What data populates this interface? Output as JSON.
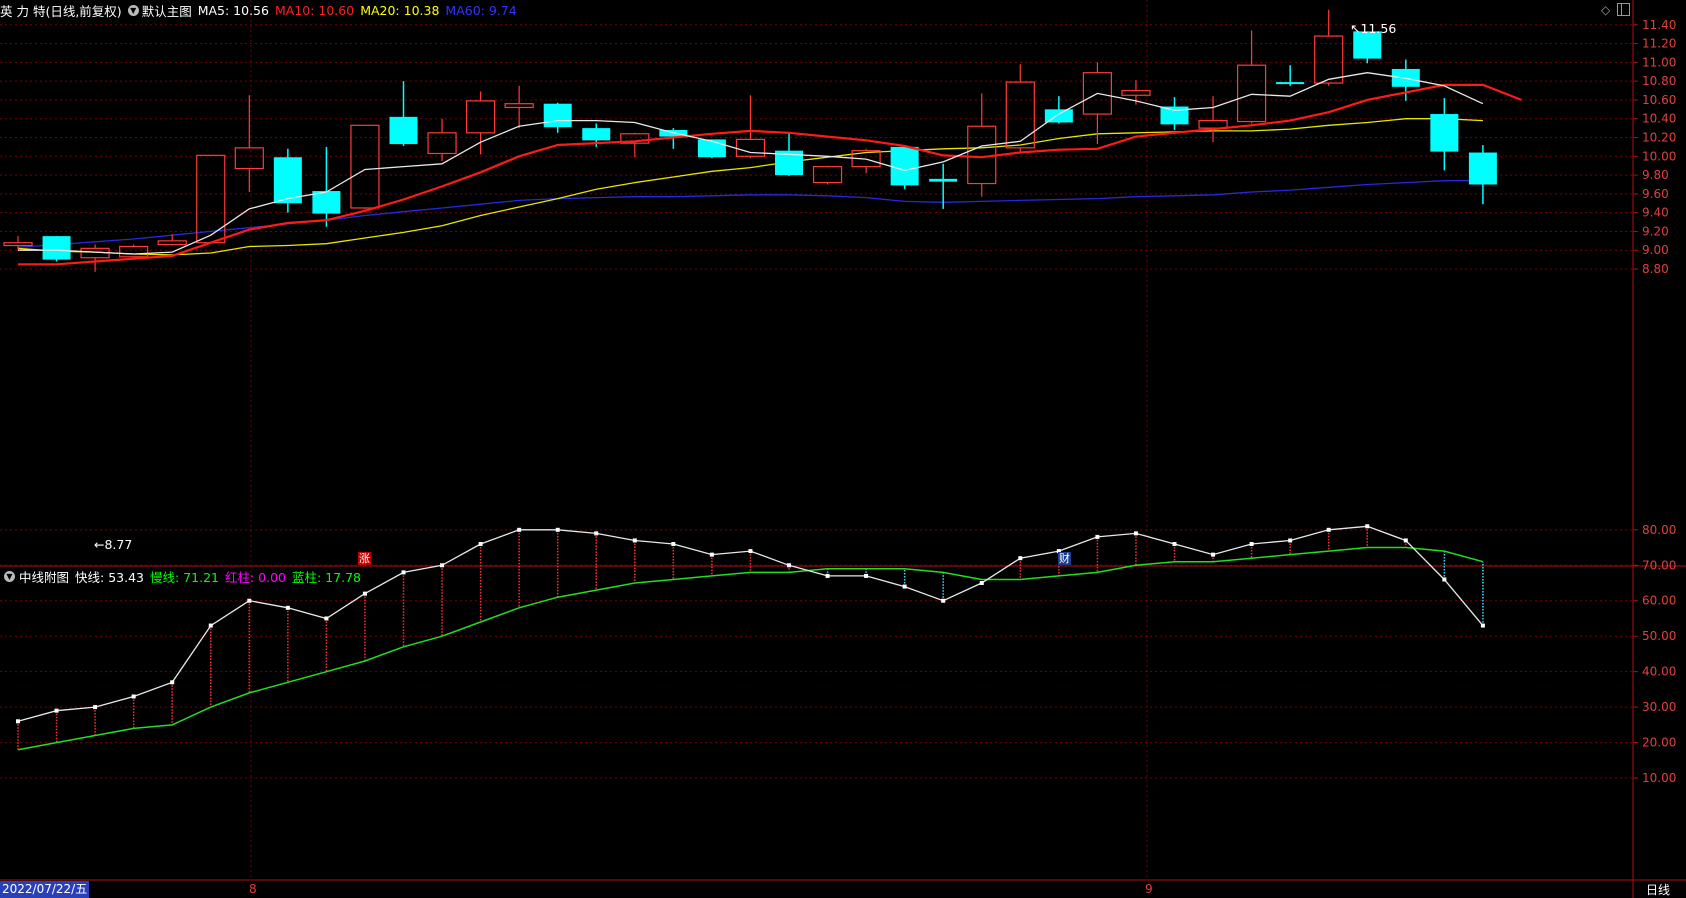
{
  "main_header": {
    "stock_name": "英 力 特",
    "period": "(日线,前复权)",
    "indicator_menu": "默认主图",
    "ma5": "MA5: 10.56",
    "ma10": "MA10: 10.60",
    "ma20": "MA20: 10.38",
    "ma60": "MA60: 9.74",
    "colors": {
      "ma5": "#ffffff",
      "ma10": "#ff2020",
      "ma20": "#ffff00",
      "ma60": "#3333ff"
    }
  },
  "sub_header": {
    "indicator_menu": "中线附图",
    "fast": "快线: 53.43",
    "slow": "慢线: 71.21",
    "red_bar": "红柱: 0.00",
    "blue_bar": "蓝柱: 17.78",
    "colors": {
      "fast": "#ffffff",
      "slow": "#00ff00",
      "red": "#ff00ff",
      "blue": "#00ff00"
    }
  },
  "annotations": {
    "high": "11.56",
    "low": "8.77"
  },
  "markers": {
    "zhang": "涨",
    "cai": "财"
  },
  "bottom": {
    "date": "2022/07/22/五",
    "month_aug": "8",
    "month_sep": "9",
    "period_button": "日线"
  },
  "chart_data": [
    {
      "type": "candlestick",
      "title": "",
      "ylim": [
        8.7,
        11.7
      ],
      "y_ticks": [
        "11.40",
        "11.20",
        "11.00",
        "10.80",
        "10.60",
        "10.40",
        "10.20",
        "10.00",
        "9.80",
        "9.60",
        "9.40",
        "9.20",
        "9.00",
        "8.80"
      ],
      "candles": [
        {
          "o": 9.05,
          "c": 9.08,
          "h": 9.15,
          "l": 9.0
        },
        {
          "o": 9.15,
          "c": 8.9,
          "h": 9.15,
          "l": 8.88
        },
        {
          "o": 8.92,
          "c": 9.02,
          "h": 9.06,
          "l": 8.77
        },
        {
          "o": 8.93,
          "c": 9.04,
          "h": 9.06,
          "l": 8.92
        },
        {
          "o": 9.06,
          "c": 9.1,
          "h": 9.17,
          "l": 9.05
        },
        {
          "o": 9.08,
          "c": 10.01,
          "h": 10.01,
          "l": 9.08
        },
        {
          "o": 9.87,
          "c": 10.09,
          "h": 10.65,
          "l": 9.62
        },
        {
          "o": 9.99,
          "c": 9.5,
          "h": 10.08,
          "l": 9.4
        },
        {
          "o": 9.63,
          "c": 9.39,
          "h": 10.1,
          "l": 9.25
        },
        {
          "o": 9.45,
          "c": 10.33,
          "h": 10.33,
          "l": 9.44
        },
        {
          "o": 10.42,
          "c": 10.13,
          "h": 10.8,
          "l": 10.11
        },
        {
          "o": 10.03,
          "c": 10.25,
          "h": 10.4,
          "l": 9.95
        },
        {
          "o": 10.25,
          "c": 10.59,
          "h": 10.69,
          "l": 10.02
        },
        {
          "o": 10.52,
          "c": 10.56,
          "h": 10.75,
          "l": 10.3
        },
        {
          "o": 10.56,
          "c": 10.31,
          "h": 10.57,
          "l": 10.25
        },
        {
          "o": 10.3,
          "c": 10.17,
          "h": 10.35,
          "l": 10.1
        },
        {
          "o": 10.14,
          "c": 10.24,
          "h": 10.25,
          "l": 9.99
        },
        {
          "o": 10.28,
          "c": 10.21,
          "h": 10.3,
          "l": 10.08
        },
        {
          "o": 10.18,
          "c": 9.99,
          "h": 10.18,
          "l": 9.98
        },
        {
          "o": 10.0,
          "c": 10.18,
          "h": 10.65,
          "l": 9.98
        },
        {
          "o": 10.06,
          "c": 9.8,
          "h": 10.25,
          "l": 9.79
        },
        {
          "o": 9.72,
          "c": 9.89,
          "h": 9.9,
          "l": 9.7
        },
        {
          "o": 9.89,
          "c": 10.06,
          "h": 10.08,
          "l": 9.82
        },
        {
          "o": 10.1,
          "c": 9.69,
          "h": 10.12,
          "l": 9.65
        },
        {
          "o": 9.76,
          "c": 9.73,
          "h": 9.92,
          "l": 9.44
        },
        {
          "o": 9.71,
          "c": 10.32,
          "h": 10.67,
          "l": 9.57
        },
        {
          "o": 10.09,
          "c": 10.79,
          "h": 10.98,
          "l": 10.03
        },
        {
          "o": 10.5,
          "c": 10.36,
          "h": 10.64,
          "l": 10.35
        },
        {
          "o": 10.45,
          "c": 10.89,
          "h": 11.0,
          "l": 10.13
        },
        {
          "o": 10.65,
          "c": 10.7,
          "h": 10.81,
          "l": 10.55
        },
        {
          "o": 10.53,
          "c": 10.34,
          "h": 10.63,
          "l": 10.28
        },
        {
          "o": 10.3,
          "c": 10.38,
          "h": 10.64,
          "l": 10.15
        },
        {
          "o": 10.37,
          "c": 10.97,
          "h": 11.34,
          "l": 10.35
        },
        {
          "o": 10.79,
          "c": 10.77,
          "h": 10.97,
          "l": 10.75
        },
        {
          "o": 10.78,
          "c": 11.28,
          "h": 11.56,
          "l": 10.75
        },
        {
          "o": 11.33,
          "c": 11.04,
          "h": 11.33,
          "l": 10.99
        },
        {
          "o": 10.93,
          "c": 10.74,
          "h": 11.03,
          "l": 10.59
        },
        {
          "o": 10.45,
          "c": 10.05,
          "h": 10.62,
          "l": 9.85
        },
        {
          "o": 10.04,
          "c": 9.7,
          "h": 10.12,
          "l": 9.49
        }
      ],
      "ma5": [
        9.0,
        9.0,
        8.98,
        8.96,
        8.98,
        9.16,
        9.44,
        9.55,
        9.62,
        9.86,
        9.89,
        9.92,
        10.15,
        10.32,
        10.38,
        10.38,
        10.36,
        10.25,
        10.16,
        10.04,
        10.02,
        10.0,
        9.97,
        9.85,
        9.94,
        10.11,
        10.16,
        10.45,
        10.67,
        10.59,
        10.49,
        10.52,
        10.66,
        10.64,
        10.82,
        10.89,
        10.83,
        10.75,
        10.56
      ],
      "ma10": [
        8.85,
        8.85,
        8.88,
        8.91,
        8.94,
        9.08,
        9.22,
        9.29,
        9.32,
        9.42,
        9.54,
        9.68,
        9.83,
        10.0,
        10.12,
        10.14,
        10.16,
        10.2,
        10.24,
        10.27,
        10.25,
        10.21,
        10.17,
        10.11,
        10.01,
        9.99,
        10.04,
        10.07,
        10.08,
        10.21,
        10.25,
        10.29,
        10.33,
        10.38,
        10.47,
        10.6,
        10.68,
        10.76,
        10.76,
        10.6
      ],
      "ma20": [
        9.02,
        8.99,
        8.98,
        8.96,
        8.95,
        8.97,
        9.04,
        9.05,
        9.07,
        9.13,
        9.19,
        9.26,
        9.37,
        9.46,
        9.55,
        9.65,
        9.72,
        9.78,
        9.84,
        9.88,
        9.94,
        9.99,
        10.04,
        10.06,
        10.08,
        10.09,
        10.12,
        10.19,
        10.24,
        10.25,
        10.26,
        10.27,
        10.27,
        10.29,
        10.33,
        10.36,
        10.4,
        10.4,
        10.38
      ],
      "ma60": [
        9.03,
        9.06,
        9.09,
        9.12,
        9.16,
        9.2,
        9.24,
        9.28,
        9.32,
        9.37,
        9.41,
        9.45,
        9.49,
        9.53,
        9.55,
        9.56,
        9.57,
        9.57,
        9.58,
        9.59,
        9.59,
        9.58,
        9.56,
        9.52,
        9.51,
        9.52,
        9.53,
        9.54,
        9.55,
        9.57,
        9.58,
        9.59,
        9.62,
        9.64,
        9.67,
        9.7,
        9.72,
        9.74,
        9.74
      ]
    },
    {
      "type": "line",
      "title": "",
      "ylim": [
        0,
        85
      ],
      "y_ticks": [
        "80.00",
        "70.00",
        "60.00",
        "50.00",
        "40.00",
        "30.00",
        "20.00",
        "10.00"
      ],
      "series": [
        {
          "name": "快线",
          "values": [
            26,
            29,
            30,
            33,
            37,
            53,
            60,
            58,
            55,
            62,
            68,
            70,
            76,
            80,
            80,
            79,
            77,
            76,
            73,
            74,
            70,
            67,
            67,
            64,
            60,
            65,
            72,
            74,
            78,
            79,
            76,
            73,
            76,
            77,
            80,
            81,
            77,
            66,
            53
          ]
        },
        {
          "name": "慢线",
          "values": [
            18,
            20,
            22,
            24,
            25,
            30,
            34,
            37,
            40,
            43,
            47,
            50,
            54,
            58,
            61,
            63,
            65,
            66,
            67,
            68,
            68,
            69,
            69,
            69,
            68,
            66,
            66,
            67,
            68,
            70,
            71,
            71,
            72,
            73,
            74,
            75,
            75,
            74,
            71
          ]
        }
      ]
    }
  ]
}
